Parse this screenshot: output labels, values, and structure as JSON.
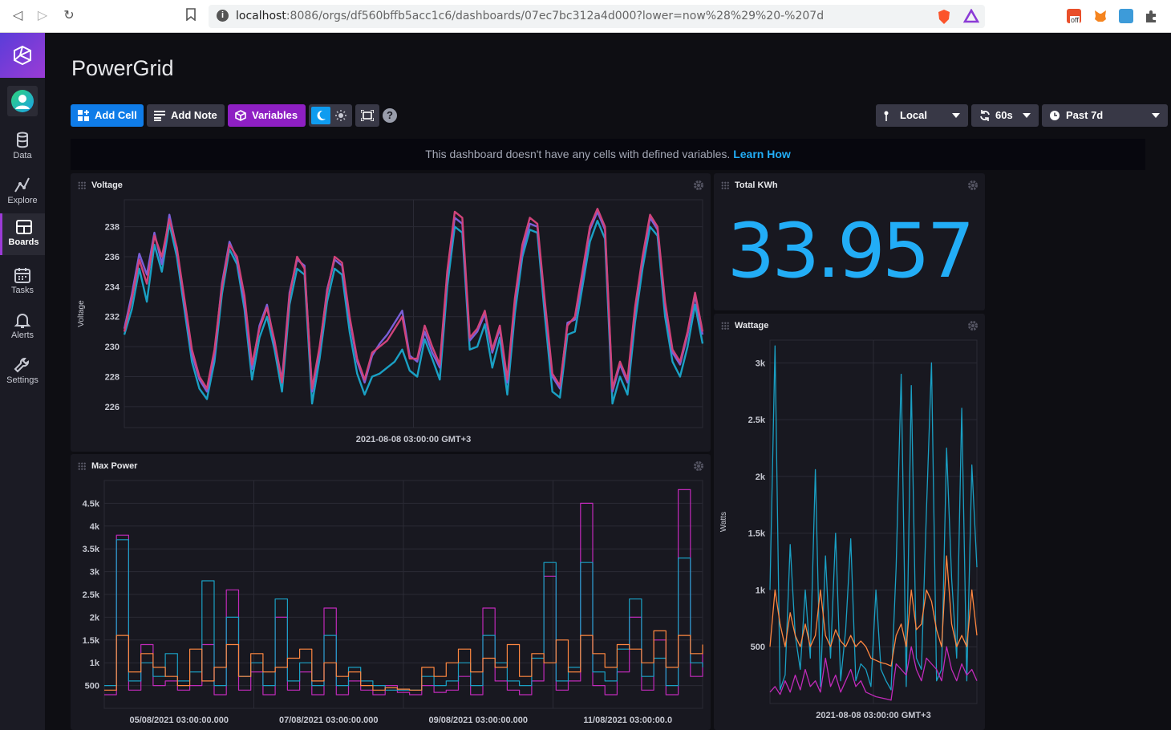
{
  "browser": {
    "url_host": "localhost",
    "url_rest": ":8086/orgs/df560bffb5acc1c6/dashboards/07ec7bc312a4d000?lower=now%28%29%20-%207d",
    "ext_badge": "off"
  },
  "sidebar": {
    "items": [
      {
        "label": "Data",
        "icon": "database-icon"
      },
      {
        "label": "Explore",
        "icon": "graph-icon"
      },
      {
        "label": "Boards",
        "icon": "dashboard-icon"
      },
      {
        "label": "Tasks",
        "icon": "calendar-icon"
      },
      {
        "label": "Alerts",
        "icon": "bell-icon"
      },
      {
        "label": "Settings",
        "icon": "wrench-icon"
      }
    ],
    "active": "Boards"
  },
  "page": {
    "title": "PowerGrid"
  },
  "toolbar": {
    "add_cell": "Add Cell",
    "add_note": "Add Note",
    "variables": "Variables",
    "timezone": "Local",
    "refresh": "60s",
    "time_range": "Past 7d",
    "help": "?"
  },
  "banner": {
    "text": "This dashboard doesn't have any cells with defined variables.",
    "link": "Learn How"
  },
  "colors": {
    "accent": "#22adf6",
    "add_cell": "#0f7ce8",
    "variables": "#8e1fc3",
    "series_teal": "#1aa0c4",
    "series_purple": "#7a5fd8",
    "series_pink": "#d0437a",
    "series_orange": "#ff8740",
    "series_magenta": "#c02ab9"
  },
  "cells": {
    "voltage": {
      "title": "Voltage"
    },
    "total_kwh": {
      "title": "Total KWh",
      "value": "33.957"
    },
    "wattage": {
      "title": "Wattage"
    },
    "max_power": {
      "title": "Max Power"
    }
  },
  "chart_data": [
    {
      "type": "line",
      "title": "Voltage",
      "ylabel": "Voltage",
      "xlabel": "",
      "ylim": [
        224.6,
        239.8
      ],
      "yticks": [
        "238",
        "236",
        "234",
        "232",
        "230",
        "228",
        "226"
      ],
      "ytick_values": [
        238,
        236,
        234,
        232,
        230,
        228,
        226
      ],
      "xticks": [
        "2021-08-08 03:00:00 GMT+3"
      ],
      "series": [
        {
          "values": [
            230.8,
            232.5,
            235.2,
            233.0,
            236.8,
            235.0,
            238.2,
            236.0,
            232.5,
            229.0,
            227.2,
            226.5,
            229.0,
            233.5,
            236.5,
            235.5,
            232.5,
            227.8,
            230.6,
            232.0,
            229.8,
            227.0,
            232.8,
            235.2,
            234.8,
            226.2,
            229.2,
            233.0,
            235.2,
            234.8,
            231.0,
            228.2,
            226.8,
            228.0,
            228.2,
            228.6,
            229.0,
            229.8,
            228.4,
            228.0,
            230.5,
            229.2,
            227.8,
            234.0,
            238.0,
            237.6,
            229.8,
            230.0,
            231.5,
            228.6,
            230.6,
            226.8,
            232.2,
            236.0,
            237.8,
            237.6,
            232.0,
            227.0,
            226.6,
            230.8,
            231.0,
            234.0,
            237.0,
            238.4,
            237.2,
            226.2,
            228.0,
            226.8,
            231.6,
            235.2,
            238.0,
            237.4,
            232.0,
            229.0,
            228.0,
            230.0,
            232.8,
            230.2
          ]
        },
        {
          "values": [
            231.2,
            233.5,
            236.2,
            234.8,
            237.6,
            235.5,
            238.8,
            236.5,
            233.0,
            229.5,
            227.8,
            227.0,
            229.5,
            234.2,
            237.0,
            235.8,
            233.0,
            228.5,
            231.4,
            232.8,
            230.2,
            227.8,
            233.6,
            235.8,
            235.4,
            227.0,
            229.8,
            233.8,
            235.8,
            235.4,
            231.8,
            229.0,
            227.6,
            229.4,
            230.2,
            230.8,
            231.6,
            232.4,
            229.4,
            229.0,
            231.0,
            229.6,
            228.6,
            234.8,
            238.6,
            238.2,
            230.4,
            231.0,
            232.2,
            229.6,
            231.2,
            227.6,
            233.0,
            236.4,
            238.2,
            238.0,
            232.8,
            228.0,
            227.2,
            231.6,
            231.8,
            234.6,
            237.8,
            239.0,
            237.8,
            227.0,
            228.8,
            227.6,
            232.4,
            235.8,
            238.6,
            237.8,
            232.8,
            229.6,
            228.8,
            230.8,
            233.4,
            230.8
          ]
        },
        {
          "values": [
            231.0,
            233.2,
            235.8,
            234.2,
            237.4,
            236.0,
            238.5,
            236.6,
            233.2,
            229.8,
            228.0,
            227.2,
            229.8,
            234.0,
            236.8,
            236.0,
            233.4,
            228.8,
            231.2,
            232.6,
            230.4,
            227.6,
            233.4,
            236.0,
            235.2,
            227.2,
            230.0,
            233.6,
            236.0,
            235.6,
            232.0,
            229.2,
            227.8,
            229.6,
            230.0,
            230.4,
            231.2,
            232.0,
            229.2,
            229.2,
            231.4,
            230.0,
            228.8,
            235.0,
            239.0,
            238.6,
            230.6,
            231.2,
            232.4,
            229.8,
            231.4,
            227.8,
            233.2,
            236.8,
            238.6,
            238.2,
            233.0,
            228.2,
            227.4,
            231.4,
            232.0,
            235.0,
            238.0,
            239.2,
            238.0,
            227.2,
            229.0,
            227.8,
            232.6,
            236.0,
            238.8,
            238.0,
            233.0,
            229.8,
            229.0,
            231.0,
            233.6,
            231.0
          ]
        }
      ]
    },
    {
      "type": "line",
      "title": "Wattage",
      "ylabel": "Watts",
      "xlabel": "",
      "ylim": [
        0,
        3200
      ],
      "yticks": [
        "3k",
        "2.5k",
        "2k",
        "1.5k",
        "1k",
        "500"
      ],
      "ytick_values": [
        3000,
        2500,
        2000,
        1500,
        1000,
        500
      ],
      "xticks": [
        "2021-08-08 03:00:00 GMT+3"
      ],
      "series": [
        {
          "values": [
            1000,
            3150,
            120,
            250,
            1400,
            600,
            300,
            1000,
            400,
            2060,
            150,
            1300,
            400,
            1500,
            200,
            650,
            1450,
            200,
            350,
            300,
            150,
            1000,
            300,
            200,
            120,
            1200,
            2900,
            150,
            2800,
            400,
            300,
            1700,
            3000,
            200,
            300,
            2250,
            1100,
            400,
            2600,
            200,
            2100,
            1200
          ]
        },
        {
          "values": [
            500,
            1000,
            700,
            500,
            800,
            600,
            500,
            700,
            500,
            600,
            1000,
            600,
            500,
            650,
            550,
            500,
            600,
            500,
            550,
            500,
            400,
            380,
            360,
            350,
            330,
            600,
            700,
            500,
            1000,
            650,
            700,
            1000,
            900,
            650,
            500,
            1300,
            700,
            500,
            600,
            500,
            1000,
            600
          ]
        },
        {
          "values": [
            100,
            150,
            80,
            200,
            100,
            250,
            120,
            300,
            150,
            200,
            100,
            400,
            150,
            250,
            100,
            200,
            300,
            150,
            200,
            100,
            80,
            60,
            50,
            40,
            30,
            350,
            300,
            250,
            500,
            300,
            200,
            400,
            350,
            300,
            200,
            500,
            300,
            200,
            350,
            250,
            300,
            200
          ]
        }
      ]
    },
    {
      "type": "line",
      "title": "Max Power",
      "xlabel": "",
      "ylabel": "",
      "ylim": [
        0,
        5000
      ],
      "yticks": [
        "4.5k",
        "4k",
        "3.5k",
        "3k",
        "2.5k",
        "2k",
        "1.5k",
        "1k",
        "500"
      ],
      "ytick_values": [
        4500,
        4000,
        3500,
        3000,
        2500,
        2000,
        1500,
        1000,
        500
      ],
      "xticks": [
        "05/08/2021 03:00:00.000",
        "07/08/2021 03:00:00.000",
        "09/08/2021 03:00:00.000",
        "11/08/2021 03:00:00.0"
      ],
      "series": [
        {
          "values": [
            300,
            3800,
            400,
            1400,
            500,
            600,
            400,
            500,
            1400,
            300,
            2600,
            400,
            800,
            300,
            2000,
            400,
            800,
            300,
            2200,
            300,
            600,
            400,
            300,
            500,
            350,
            300,
            500,
            350,
            400,
            700,
            300,
            2200,
            600,
            400,
            300,
            600,
            2900,
            400,
            600,
            4500,
            500,
            300,
            800,
            2000,
            400,
            1500,
            300,
            4800,
            700,
            1200
          ]
        },
        {
          "values": [
            500,
            3700,
            600,
            1000,
            700,
            1200,
            600,
            800,
            2800,
            500,
            2000,
            700,
            1000,
            500,
            2400,
            600,
            1000,
            500,
            1600,
            500,
            900,
            600,
            500,
            400,
            400,
            400,
            700,
            500,
            600,
            1000,
            500,
            1600,
            1000,
            600,
            500,
            1100,
            3200,
            600,
            900,
            3200,
            800,
            600,
            1300,
            2400,
            700,
            1100,
            500,
            3300,
            1000,
            900
          ]
        },
        {
          "values": [
            400,
            1600,
            800,
            1200,
            900,
            700,
            500,
            1300,
            600,
            900,
            1400,
            700,
            1200,
            800,
            900,
            1100,
            1300,
            600,
            1000,
            700,
            800,
            500,
            400,
            450,
            420,
            400,
            900,
            700,
            1000,
            1300,
            800,
            1100,
            900,
            1400,
            700,
            1200,
            1000,
            1500,
            800,
            1600,
            1200,
            900,
            1400,
            1300,
            1000,
            1700,
            900,
            1600,
            1200,
            1400
          ]
        }
      ]
    }
  ]
}
